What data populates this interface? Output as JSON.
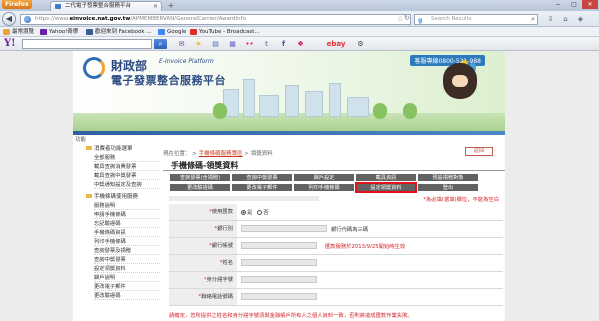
{
  "browser": {
    "app_button": "Firefox",
    "tab_title": "二代電子發票整合服務平台",
    "url_prefix": "https://www.",
    "url_domain": "einvoice.nat.gov.tw",
    "url_path": "/APMEMBERVAN/GeneralCarrier/AwardInfo",
    "search_placeholder": "Search Results",
    "search_engine_glyph": "g",
    "new_tab_glyph": "+",
    "tab_close_glyph": "✕",
    "window_controls": [
      "−",
      "□",
      "✕"
    ],
    "icons": [
      "back-icon",
      "globe-icon",
      "star-icon",
      "refresh-icon",
      "magnifier-icon",
      "download-icon",
      "home-icon"
    ]
  },
  "bookmarks": [
    {
      "label": "最常瀏覽",
      "color": "#e8a33a"
    },
    {
      "label": "Yahoo!奇摩",
      "color": "#6b1fa8"
    },
    {
      "label": "歡迎來到 Facebook ...",
      "color": "#3b5998"
    },
    {
      "label": "Google",
      "color": "#4285f4"
    },
    {
      "label": "YouTube - Broadcast...",
      "color": "#e52d27"
    }
  ],
  "yahoo_toolbar": {
    "logo": "Y!",
    "search_button_glyph": "⌕",
    "icons": [
      "mail-icon",
      "weather-icon",
      "news-icon",
      "finance-icon",
      "flickr-icon",
      "bookmark-icon",
      "facebook-icon",
      "ebay-icon",
      "settings-icon"
    ],
    "ebay_label": "ebay"
  },
  "banner": {
    "org": "財政部",
    "org_en": "E-Invoice Platform",
    "platform": "電子發票整合服務平台",
    "hotline": "客服專線0800-521-988"
  },
  "left_strip_label": "功能",
  "sidebar": {
    "section1": "消費者功能選單",
    "items1": [
      "全部服務",
      "載具查詢消費發票",
      "載具查詢中獎發票",
      "中獎通知設定及查詢"
    ],
    "section2": "手機條碼使用服務",
    "items2": [
      "服務說明",
      "申請手機條碼",
      "忘記驗證碼",
      "手機條碼資訊",
      "列印手機條碼",
      "查詢發票及捐贈",
      "查詢中獎發票",
      "設定領獎資料",
      "歸戶說明",
      "更改電子郵件",
      "更改驗證碼"
    ]
  },
  "main": {
    "breadcrumb_home": "現在位置：",
    "breadcrumb_mid": "手機條碼服務專區",
    "breadcrumb_sep": ">",
    "breadcrumb_cur": "領獎資料",
    "back_button": "返回",
    "page_title": "手機條碼-領獎資料",
    "tabs_row1": [
      "查詢發票(含捐贈)",
      "查詢中獎發票",
      "歸戶設定",
      "載具資訊",
      "預設捐贈對象"
    ],
    "tabs_row2": [
      "更改驗證碼",
      "更改電子郵件",
      "列印手機條碼",
      "設定領獎資料",
      "登出"
    ],
    "active_tab": "設定領獎資料",
    "required_note": "*為必填(選填)欄位，不能為空白",
    "form": [
      {
        "label": "使用匯款",
        "type": "radio",
        "options": [
          "是",
          "否"
        ],
        "selected": "是"
      },
      {
        "label": "銀行別",
        "type": "select",
        "value": "",
        "hint": "銀行代碼為三碼"
      },
      {
        "label": "銀行帳號",
        "type": "text",
        "value": "",
        "hint": "匯款服務於2013/9/25開始時生效"
      },
      {
        "label": "姓名",
        "type": "text",
        "value": "",
        "hint": ""
      },
      {
        "label": "身分證字號",
        "type": "text",
        "value": "",
        "hint": ""
      },
      {
        "label": "聯絡電話號碼",
        "type": "text",
        "value": "",
        "hint": ""
      }
    ],
    "footnote": "請確定，您所提供之姓名和身分證字號須與金融帳戶所有人之個人資料一致，否則將造成匯款作業失敗。"
  },
  "colors": {
    "accent_blue": "#2d6fb8",
    "tab_gray": "#626262",
    "active_outline": "#e0141b",
    "warning_red": "#d4232a"
  }
}
